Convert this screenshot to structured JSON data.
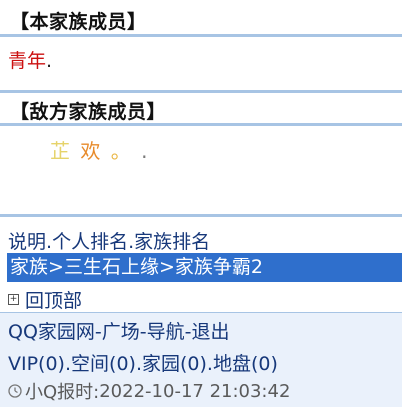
{
  "own_section": {
    "title": "【本家族成员】",
    "member_name": "青年",
    "member_suffix": "."
  },
  "enemy_section": {
    "title": "【敌方家族成员】",
    "chars": [
      "芷",
      "欢",
      "。",
      "."
    ]
  },
  "nav": {
    "links": [
      {
        "label": "说明"
      },
      {
        "label": "个人排名"
      },
      {
        "label": "家族排名"
      }
    ],
    "separator": "."
  },
  "breadcrumb": {
    "items": [
      "家族",
      "三生石上缘",
      "家族争霸2"
    ],
    "separator": ">"
  },
  "back_to_top": {
    "icon": "expand-box-icon",
    "label": "回顶部"
  },
  "footer": {
    "row1": [
      "QQ家园网",
      "广场",
      "导航",
      "退出"
    ],
    "row1_sep": "-",
    "row2": [
      "VIP(0)",
      "空间(0)",
      "家园(0)",
      "地盘(0)"
    ],
    "row2_sep": ".",
    "time_prefix": "小Q报时:",
    "time_value": "2022-10-17 21:03:42"
  },
  "colors": {
    "rule": "#a7c4e4",
    "link": "#17387a",
    "crumb_bg": "#2f6fcc",
    "footer_bg": "#eaf1fb",
    "own_member": "#cc1111"
  }
}
